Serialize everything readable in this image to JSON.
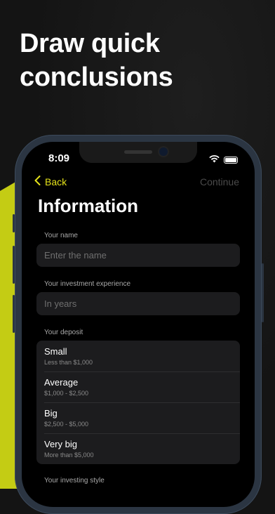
{
  "headline": {
    "line1": "Draw quick",
    "line2": "conclusions"
  },
  "status_bar": {
    "time": "8:09"
  },
  "nav": {
    "back_label": "Back",
    "continue_label": "Continue"
  },
  "page_title": "Information",
  "form": {
    "name": {
      "label": "Your name",
      "placeholder": "Enter the name"
    },
    "experience": {
      "label": "Your investment experience",
      "placeholder": "In years"
    },
    "deposit": {
      "label": "Your deposit",
      "options": [
        {
          "name": "Small",
          "range": "Less than $1,000"
        },
        {
          "name": "Average",
          "range": "$1,000 - $2,500"
        },
        {
          "name": "Big",
          "range": "$2,500 - $5,000"
        },
        {
          "name": "Very big",
          "range": "More than $5,000"
        }
      ]
    },
    "style": {
      "label": "Your investing style"
    }
  },
  "colors": {
    "accent": "#e4e21a",
    "lime": "#c4cc14",
    "field_bg": "#1c1c1e",
    "frame": "#2b3542"
  }
}
